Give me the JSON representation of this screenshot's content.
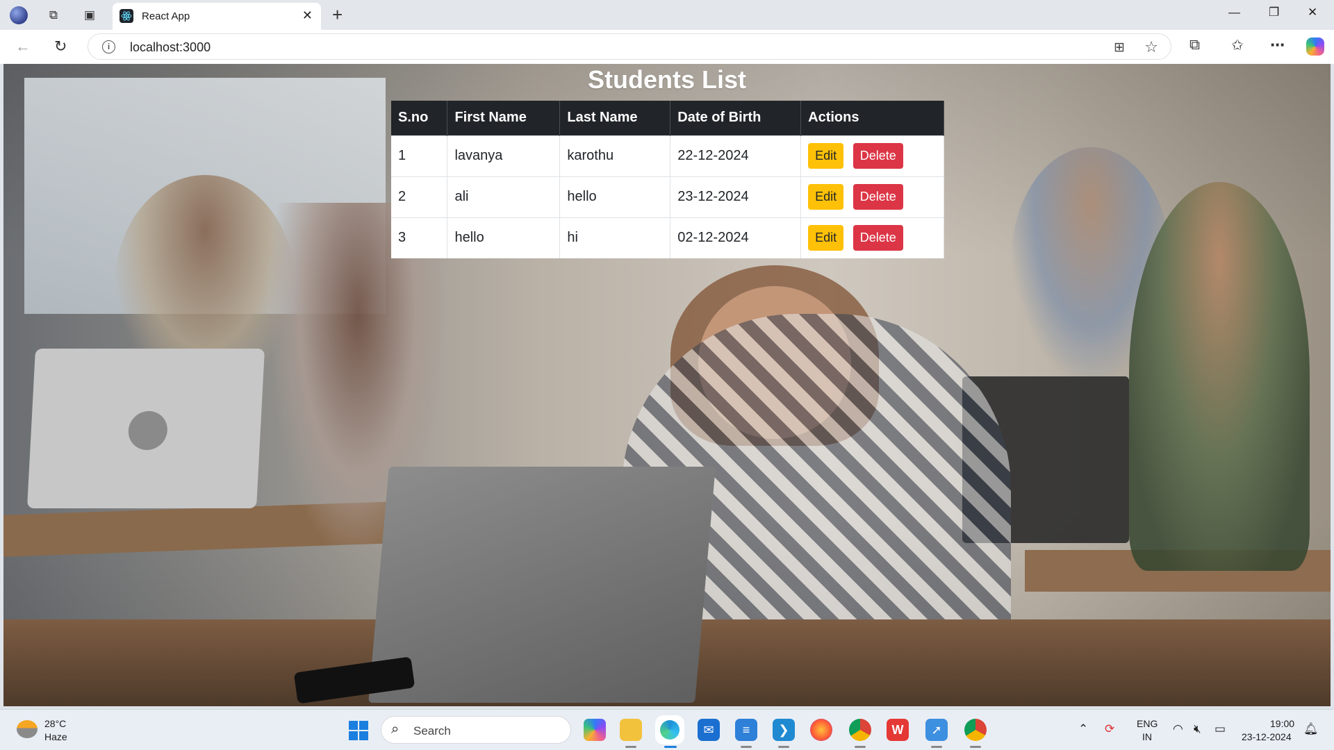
{
  "browser": {
    "tab_title": "React App",
    "close_glyph": "✕",
    "newtab_glyph": "+",
    "url": "localhost:3000",
    "window": {
      "minimize": "—",
      "maximize": "❐",
      "close": "✕"
    }
  },
  "page": {
    "title": "Students List",
    "columns": [
      "S.no",
      "First Name",
      "Last Name",
      "Date of Birth",
      "Actions"
    ],
    "rows": [
      {
        "sno": "1",
        "first": "lavanya",
        "last": "karothu",
        "dob": "22-12-2024"
      },
      {
        "sno": "2",
        "first": "ali",
        "last": "hello",
        "dob": "23-12-2024"
      },
      {
        "sno": "3",
        "first": "hello",
        "last": "hi",
        "dob": "02-12-2024"
      }
    ],
    "edit_label": "Edit",
    "delete_label": "Delete",
    "colors": {
      "header_bg": "#212529",
      "edit": "#ffc107",
      "delete": "#dc3545"
    }
  },
  "taskbar": {
    "weather_temp": "28°C",
    "weather_cond": "Haze",
    "search_placeholder": "Search",
    "lang_line1": "ENG",
    "lang_line2": "IN",
    "time": "19:00",
    "date": "23-12-2024"
  }
}
